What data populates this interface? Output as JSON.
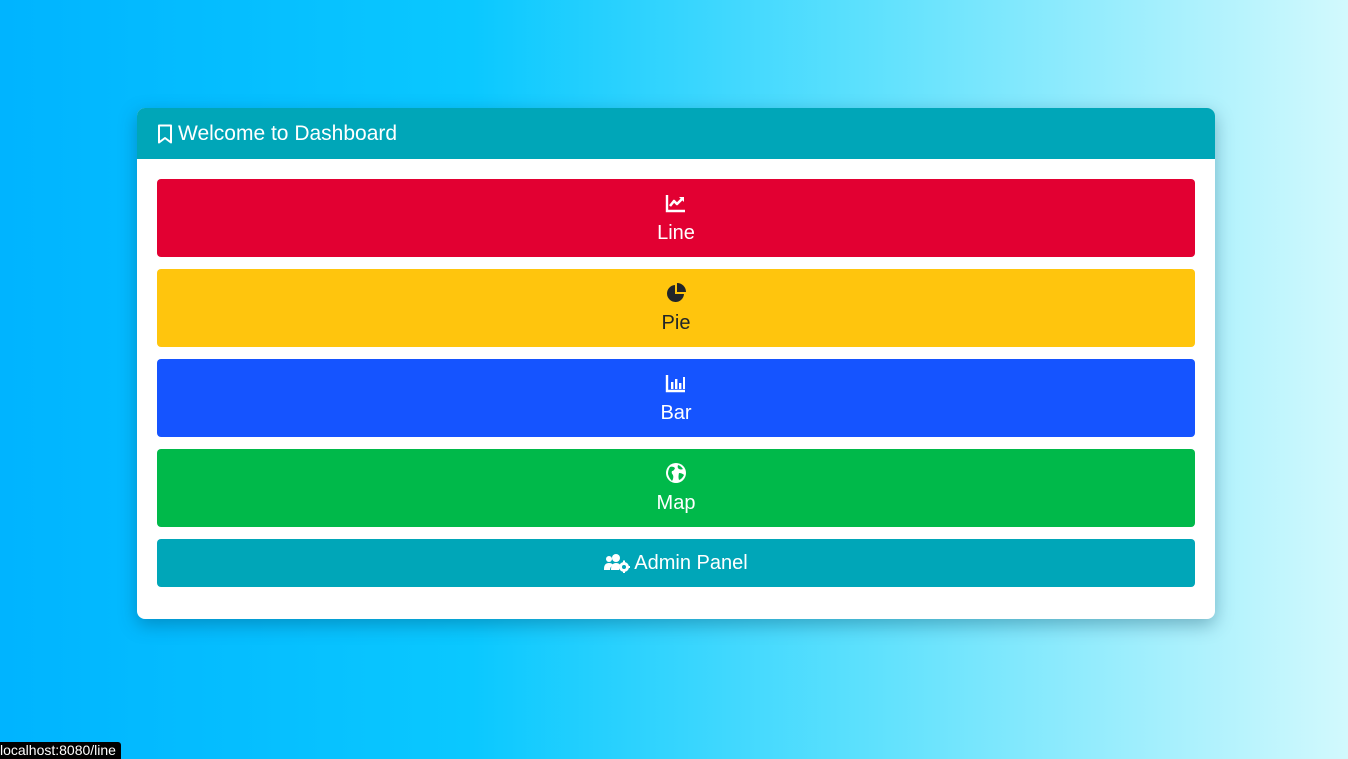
{
  "card": {
    "title": "Welcome to Dashboard",
    "title_icon": "bookmark-icon"
  },
  "buttons": [
    {
      "label": "Line",
      "icon": "line-chart-icon",
      "color": "#e20032"
    },
    {
      "label": "Pie",
      "icon": "pie-chart-icon",
      "color": "#ffc50d"
    },
    {
      "label": "Bar",
      "icon": "bar-chart-icon",
      "color": "#1554ff"
    },
    {
      "label": "Map",
      "icon": "globe-icon",
      "color": "#00b94a"
    },
    {
      "label": "Admin Panel",
      "icon": "users-cog-icon",
      "color": "#00a6b8"
    }
  ],
  "status_bar": {
    "url": "localhost:8080/line"
  },
  "colors": {
    "header": "#00a6b8",
    "background_start": "#00b4ff",
    "background_end": "#d2f9fd"
  }
}
